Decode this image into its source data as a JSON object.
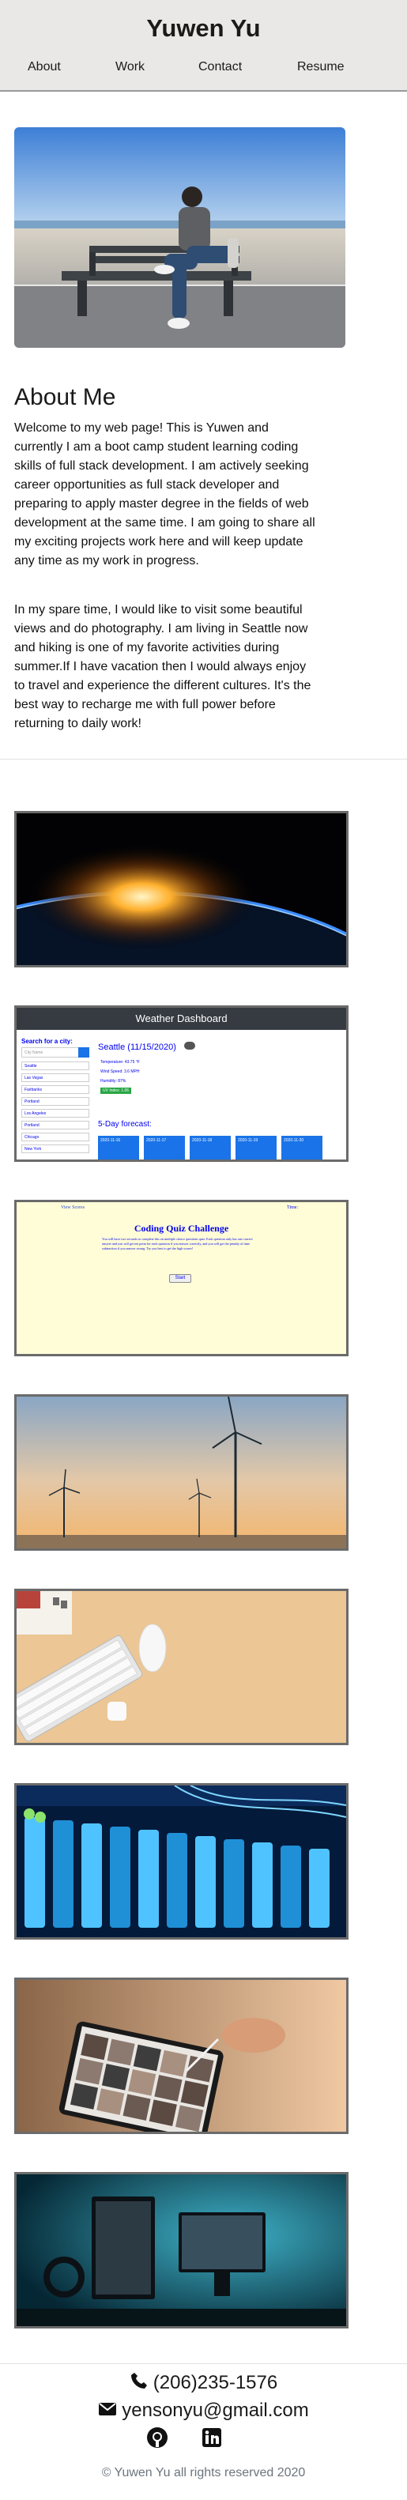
{
  "header": {
    "title": "Yuwen Yu",
    "nav": [
      "About",
      "Work",
      "Contact",
      "Resume"
    ]
  },
  "about": {
    "heading": "About Me",
    "paragraph1": "Welcome to my web page! This is Yuwen and currently I am a boot camp student learning coding skills of full stack development. I am actively seeking career opportunities as full stack developer and preparing to apply master degree in the fields of web development at the same time. I am going to share all my exciting projects work here and will keep update any time as my work in progress.",
    "paragraph2": "In my spare time, I would like to visit some beautiful views and do photography. I am living in Seattle now and hiking is one of my favorite activities during summer.If I have vacation then I would always enjoy to travel and experience the different cultures. It's the best way to recharge me with full power before returning to daily work!"
  },
  "projects": {
    "weather": {
      "title": "Weather Dashboard",
      "search_label": "Search for a city:",
      "search_placeholder": "City Name",
      "cities": [
        "Seattle",
        "Las Vegas",
        "Fairbanks",
        "Portland",
        "Los Angeles",
        "Portland",
        "Chicago",
        "New York"
      ],
      "current": "Seattle (11/15/2020)",
      "temperature": "Temperature: 43.75 °F",
      "wind": "Wind Speed: 3.6 MPH",
      "humidity": "Humidity: 87%",
      "uv": "UV Index: 1.06",
      "forecast_label": "5-Day forecast:",
      "forecast_dates": [
        "2020-11-16",
        "2020-11-17",
        "2020-11-18",
        "2020-11-19",
        "2020-11-20"
      ]
    },
    "quiz": {
      "view_scores": "View Scores",
      "time": "Time:",
      "title": "Coding Quiz Challenge",
      "description": "You will have two seconds to complete this on multiple choice questions quiz. Each question only has one correct answer and you will get ten point for each question if you answer correctly, and you will get the penalty of time subtraction if you answer wrong. Try you best to get the high scores!",
      "start": "Start"
    }
  },
  "footer": {
    "phone": "(206)235-1576",
    "email": "yensonyu@gmail.com",
    "copyright": "© Yuwen Yu all rights reserved 2020"
  },
  "icons": [
    "phone-icon",
    "envelope-icon",
    "github-icon",
    "linkedin-icon"
  ]
}
